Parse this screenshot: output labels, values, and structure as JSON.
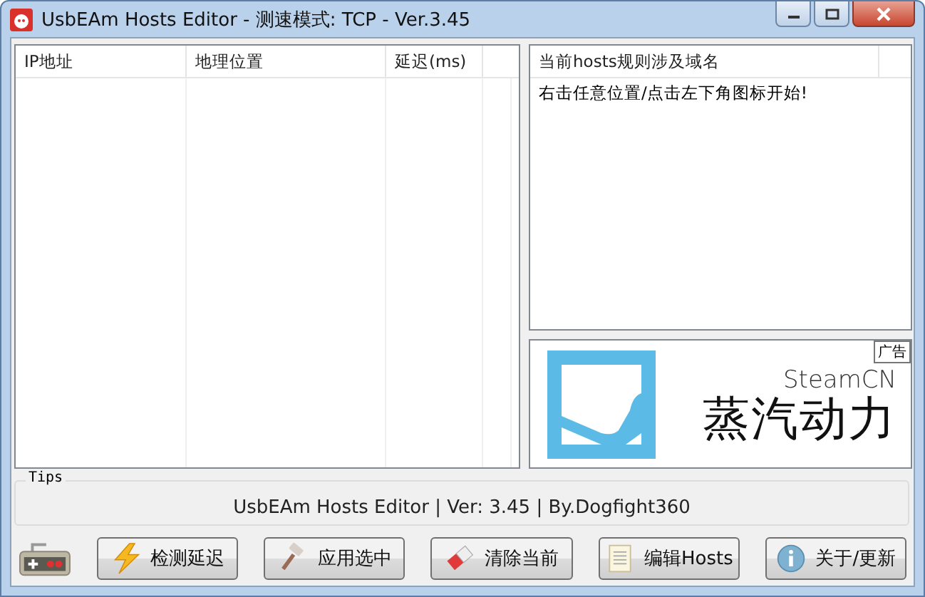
{
  "window": {
    "title": "UsbEAm Hosts Editor - 测速模式: TCP - Ver.3.45"
  },
  "ip_table": {
    "columns": [
      "IP地址",
      "地理位置",
      "延迟(ms)"
    ]
  },
  "hosts_list": {
    "columns": [
      "当前hosts规则涉及域名"
    ],
    "rows": [
      "右击任意位置/点击左下角图标开始!"
    ]
  },
  "ad": {
    "badge": "广告",
    "brand": "SteamCN",
    "brand_cn": "蒸汽动力"
  },
  "tips": {
    "legend": "Tips",
    "text": "UsbEAm Hosts Editor | Ver: 3.45 | By.Dogfight360"
  },
  "buttons": [
    {
      "kind": "bolt",
      "label": "检测延迟"
    },
    {
      "kind": "brush",
      "label": "应用选中"
    },
    {
      "kind": "eraser",
      "label": "清除当前"
    },
    {
      "kind": "document",
      "label": "编辑Hosts"
    },
    {
      "kind": "info",
      "label": "关于/更新"
    }
  ]
}
